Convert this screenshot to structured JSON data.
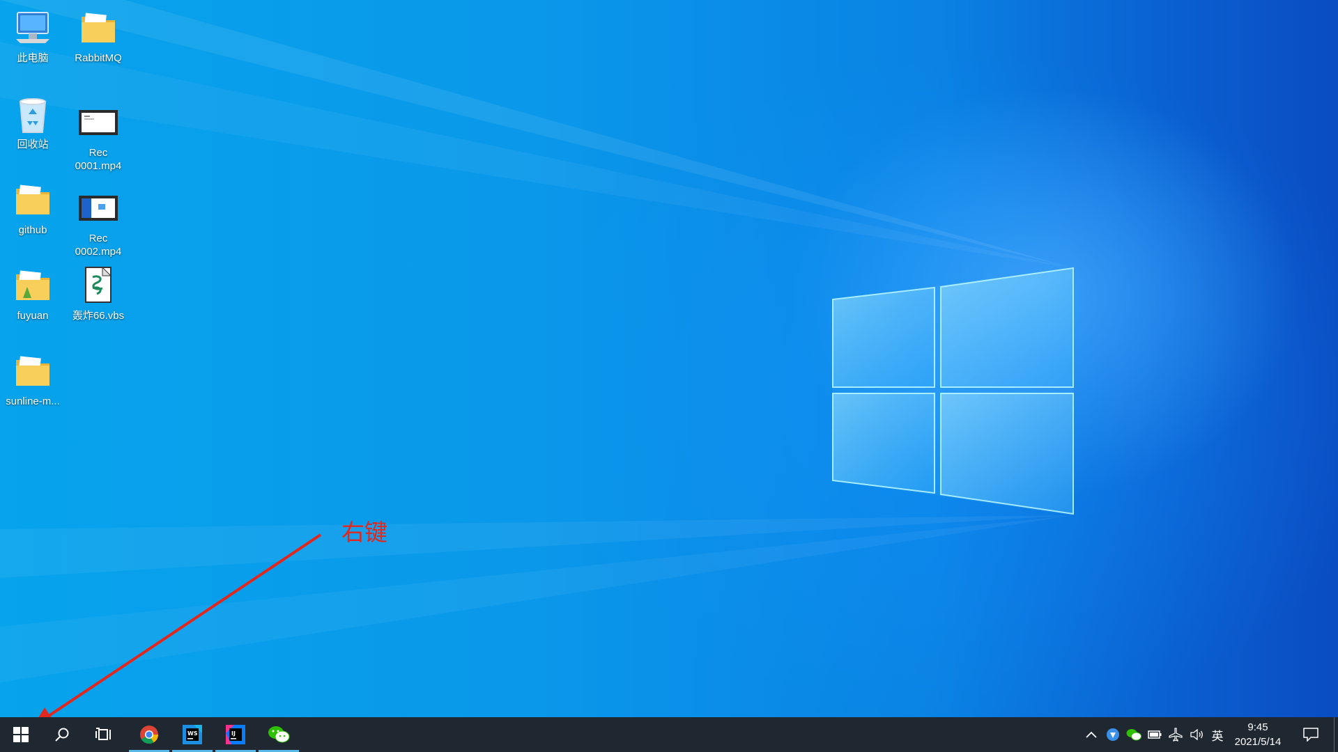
{
  "desktop": {
    "icons": [
      {
        "label": "此电脑",
        "icon": "this-pc-icon"
      },
      {
        "label": "RabbitMQ",
        "icon": "folder-icon"
      },
      {
        "label": "回收站",
        "icon": "recycle-bin-icon"
      },
      {
        "label": "Rec\n0001.mp4",
        "icon": "video-file-icon"
      },
      {
        "label": "github",
        "icon": "folder-icon"
      },
      {
        "label": "Rec\n0002.mp4",
        "icon": "video-file-icon"
      },
      {
        "label": "fuyuan",
        "icon": "folder-icon"
      },
      {
        "label": "轰炸66.vbs",
        "icon": "vbs-script-icon"
      },
      {
        "label": "sunline-m...",
        "icon": "folder-icon"
      }
    ]
  },
  "annotation": {
    "text": "右键",
    "color": "#e0281f"
  },
  "taskbar": {
    "apps": [
      {
        "name": "chrome",
        "icon": "chrome-icon"
      },
      {
        "name": "webstorm",
        "icon": "webstorm-icon"
      },
      {
        "name": "intellij",
        "icon": "intellij-icon"
      },
      {
        "name": "wechat",
        "icon": "wechat-icon"
      }
    ],
    "tray": {
      "ime": "英",
      "time": "9:45",
      "date": "2021/5/14"
    }
  },
  "colors": {
    "desktop_accent": "#0a82e4",
    "taskbar_bg": "#1f2731",
    "running_indicator": "#57b8e8"
  }
}
